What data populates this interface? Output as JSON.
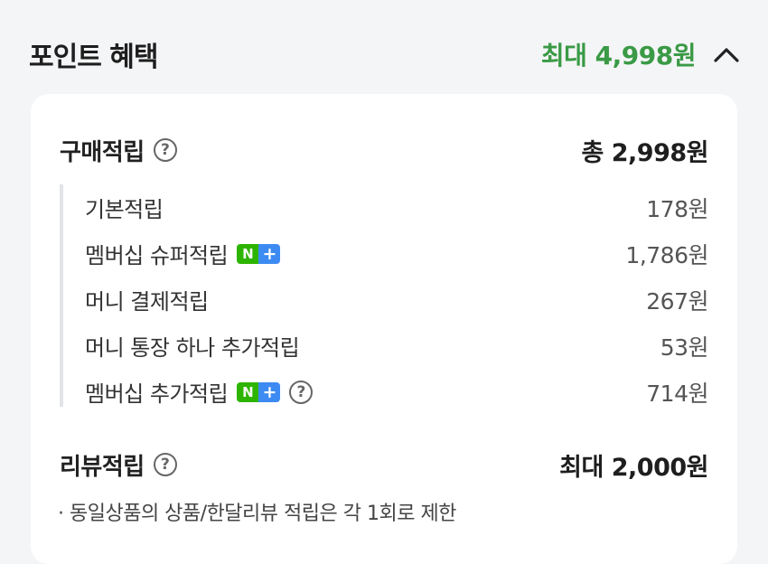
{
  "header": {
    "title": "포인트 혜택",
    "max_benefit": "최대 4,998원",
    "accent_color": "#3a9a45",
    "toggle_icon": "chevron-up-icon"
  },
  "purchase": {
    "label": "구매적립",
    "help_icon": "question-circle-icon",
    "total": "총 2,998원",
    "items": [
      {
        "label": "기본적립",
        "value": "178원"
      },
      {
        "label": "멤버십 슈퍼적립",
        "badge": "N+",
        "value": "1,786원"
      },
      {
        "label": "머니 결제적립",
        "value": "267원"
      },
      {
        "label": "머니 통장 하나 추가적립",
        "value": "53원"
      },
      {
        "label": "멤버십 추가적립",
        "badge": "N+",
        "value": "714원"
      }
    ]
  },
  "review": {
    "label": "리뷰적립",
    "help_icon": "question-circle-icon",
    "max": "최대 2,000원",
    "note": "· 동일상품의 상품/한달리뷰 적립은 각 1회로 제한"
  },
  "badge": {
    "n": "N",
    "plus": "+"
  }
}
